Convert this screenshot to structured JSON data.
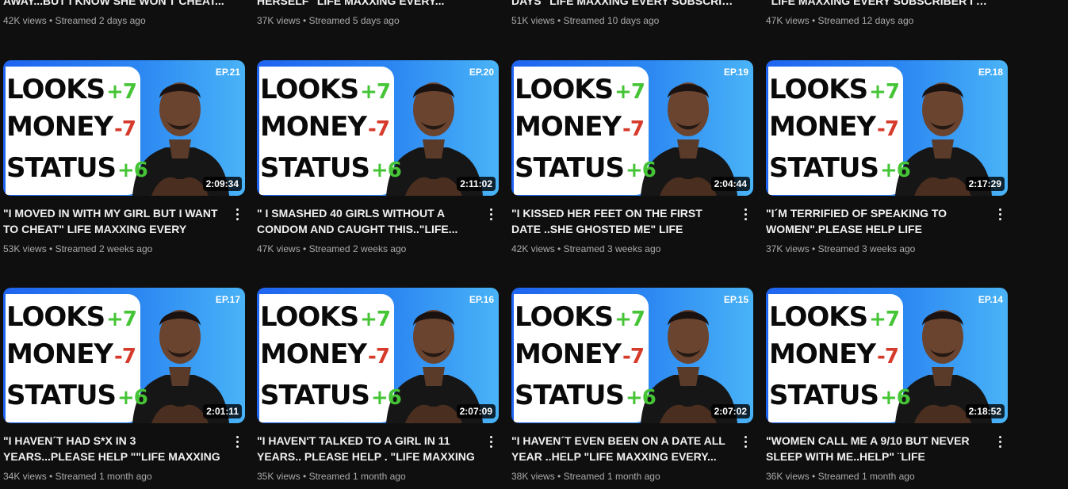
{
  "top_row": [
    {
      "title": "AWAY...BUT I KNOW SHE WON'T CHEAT...",
      "views": "42K views",
      "streamed": "Streamed 2 days ago"
    },
    {
      "title": "HERSELF\" LIFE MAXXING EVERY...",
      "views": "37K views",
      "streamed": "Streamed 5 days ago"
    },
    {
      "title": "DAYS\" LIFE MAXXING EVERY SUBSCRIBER ...",
      "views": "51K views",
      "streamed": "Streamed 10 days ago"
    },
    {
      "title": "\"LIFE MAXXING EVERY SUBSCRIBER I HAV...",
      "views": "47K views",
      "streamed": "Streamed 12 days ago"
    }
  ],
  "thumb_text": {
    "looks": "LOOKS",
    "money": "MONEY",
    "status": "STATUS",
    "looks_val": "+7",
    "money_val": "-7",
    "status_val": "+6"
  },
  "videos": [
    {
      "ep": "EP.21",
      "duration": "2:09:34",
      "title": "\"I MOVED IN WITH MY GIRL BUT I WANT TO CHEAT\" LIFE MAXXING EVERY SUBSCRIBE...",
      "views": "53K views",
      "streamed": "Streamed 2 weeks ago"
    },
    {
      "ep": "EP.20",
      "duration": "2:11:02",
      "title": "\" I SMASHED 40 GIRLS WITHOUT A CONDOM AND CAUGHT THIS..\"LIFE...",
      "views": "47K views",
      "streamed": "Streamed 2 weeks ago"
    },
    {
      "ep": "EP.19",
      "duration": "2:04:44",
      "title": "\"I KISSED HER FEET ON THE FIRST DATE ..SHE GHOSTED ME\" LIFE MAXXING EVER...",
      "views": "42K views",
      "streamed": "Streamed 3 weeks ago"
    },
    {
      "ep": "EP.18",
      "duration": "2:17:29",
      "title": "\"I´M TERRIFIED OF SPEAKING TO WOMEN\".PLEASE HELP LIFE MAXXING...",
      "views": "37K views",
      "streamed": "Streamed 3 weeks ago"
    },
    {
      "ep": "EP.17",
      "duration": "2:01:11",
      "title": "\"I HAVEN´T HAD S*X IN 3 YEARS...PLEASE HELP \"\"LIFE MAXXING EVERY SUBSCRIBE...",
      "views": "34K views",
      "streamed": "Streamed 1 month ago"
    },
    {
      "ep": "EP.16",
      "duration": "2:07:09",
      "title": "\"I HAVEN'T TALKED TO A GIRL IN 11 YEARS.. PLEASE HELP . \"LIFE MAXXING EVERY...",
      "views": "35K views",
      "streamed": "Streamed 1 month ago"
    },
    {
      "ep": "EP.15",
      "duration": "2:07:02",
      "title": "\"I HAVEN´T EVEN BEEN ON A DATE ALL YEAR ..HELP \"LIFE MAXXING EVERY...",
      "views": "38K views",
      "streamed": "Streamed 1 month ago"
    },
    {
      "ep": "EP.14",
      "duration": "2:18:52",
      "title": "\"WOMEN CALL ME A 9/10 BUT NEVER SLEEP WITH ME..HELP\" ¨LIFE MAXXING...",
      "views": "36K views",
      "streamed": "Streamed 1 month ago"
    }
  ]
}
